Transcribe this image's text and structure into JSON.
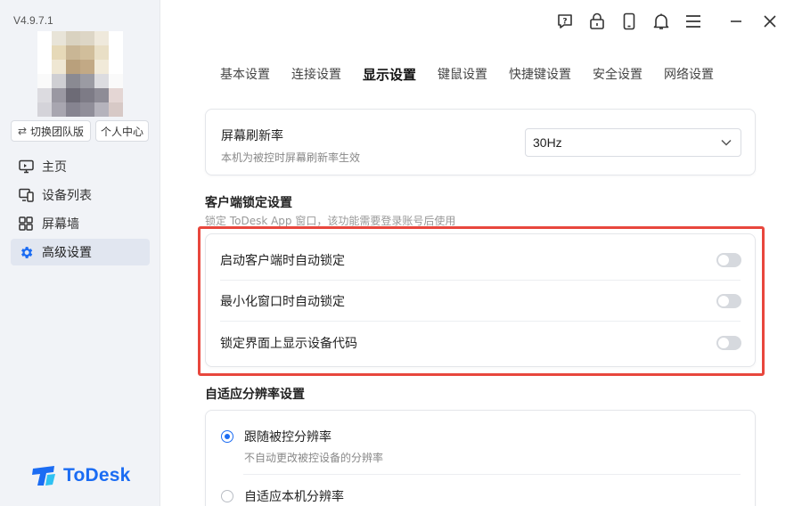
{
  "app": {
    "version": "V4.9.7.1",
    "brand_name": "ToDesk",
    "brand_color": "#1b6cf3"
  },
  "sidebar": {
    "switch_team_label": "切换团队版",
    "personal_center_label": "个人中心",
    "items": [
      {
        "label": "主页",
        "icon": "home-monitor-icon"
      },
      {
        "label": "设备列表",
        "icon": "device-list-icon"
      },
      {
        "label": "屏幕墙",
        "icon": "screen-wall-icon"
      },
      {
        "label": "高级设置",
        "icon": "gear-icon",
        "active": true
      }
    ]
  },
  "topbar": {
    "icons": [
      "help-icon",
      "lock-icon",
      "phone-icon",
      "bell-icon",
      "menu-icon"
    ],
    "window_controls": [
      "minimize-icon",
      "close-icon"
    ]
  },
  "tabs": [
    {
      "label": "基本设置"
    },
    {
      "label": "连接设置"
    },
    {
      "label": "显示设置",
      "active": true
    },
    {
      "label": "键鼠设置"
    },
    {
      "label": "快捷键设置"
    },
    {
      "label": "安全设置"
    },
    {
      "label": "网络设置"
    }
  ],
  "refresh": {
    "title": "屏幕刷新率",
    "subtitle": "本机为被控时屏幕刷新率生效",
    "value": "30Hz"
  },
  "client_lock": {
    "title": "客户端锁定设置",
    "desc": "锁定 ToDesk App 窗口，该功能需要登录账号后使用",
    "rows": [
      {
        "label": "启动客户端时自动锁定",
        "enabled": false
      },
      {
        "label": "最小化窗口时自动锁定",
        "enabled": false
      },
      {
        "label": "锁定界面上显示设备代码",
        "enabled": false
      }
    ]
  },
  "resolution": {
    "title": "自适应分辨率设置",
    "options": [
      {
        "label": "跟随被控分辨率",
        "sub": "不自动更改被控设备的分辨率",
        "checked": true
      },
      {
        "label": "自适应本机分辨率",
        "sub": "",
        "checked": false
      }
    ]
  }
}
